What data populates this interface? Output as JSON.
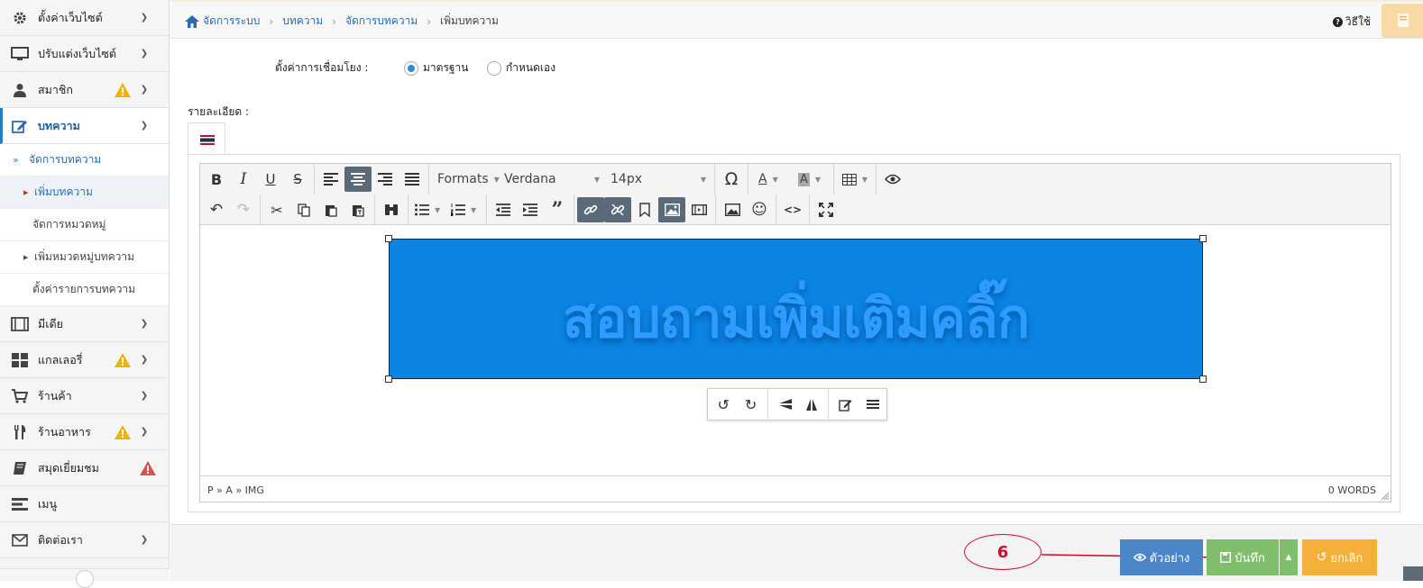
{
  "sidebar": {
    "items": [
      {
        "label": "ตั้งค่าเว็บไซต์",
        "icon": "gear-icon"
      },
      {
        "label": "ปรับแต่งเว็บไซต์",
        "icon": "monitor-icon"
      },
      {
        "label": "สมาชิก",
        "icon": "user-icon",
        "warning": true
      },
      {
        "label": "บทความ",
        "icon": "edit-icon",
        "active": true
      },
      {
        "label": "มีเดีย",
        "icon": "film-icon"
      },
      {
        "label": "แกลเลอรี่",
        "icon": "grid-icon",
        "warning": true
      },
      {
        "label": "ร้านค้า",
        "icon": "cart-icon"
      },
      {
        "label": "ร้านอาหาร",
        "icon": "utensils-icon",
        "warning": true
      },
      {
        "label": "สมุดเยี่ยมชม",
        "icon": "book-icon",
        "warning_red": true
      },
      {
        "label": "เมนู",
        "icon": "menu-icon"
      },
      {
        "label": "ติดต่อเรา",
        "icon": "envelope-icon"
      }
    ],
    "sub": [
      {
        "label": "จัดการบทความ"
      },
      {
        "label": "เพิ่มบทความ"
      },
      {
        "label": "จัดการหมวดหมู่"
      },
      {
        "label": "เพิ่มหมวดหมู่บทความ"
      },
      {
        "label": "ตั้งค่ารายการบทความ"
      }
    ]
  },
  "breadcrumb": [
    "จัดการระบบ",
    "บทความ",
    "จัดการบทความ",
    "เพิ่มบทความ"
  ],
  "help_label": "วิธีใช้",
  "form": {
    "link_label": "ตั้งค่าการเชื่อมโยง :",
    "radio_standard": "มาตรฐาน",
    "radio_custom": "กำหนดเอง",
    "detail_label": "รายละเอียด :"
  },
  "editor": {
    "formats": "Formats",
    "font": "Verdana",
    "size": "14px",
    "image_text": "สอบถามเพิ่มเติมคลิ๊ก",
    "status_path": "P » A » IMG",
    "word_count": "0 WORDS"
  },
  "footer": {
    "preview": "ตัวอย่าง",
    "save": "บันทึก",
    "cancel": "ยกเลิก",
    "annotation": "6"
  },
  "colors": {
    "accent": "#2a7bc0",
    "image_bg": "#0b84e4",
    "save": "#7fbf6b",
    "cancel": "#f5b03b",
    "preview": "#4a86c8",
    "annotation": "#c8102e"
  }
}
